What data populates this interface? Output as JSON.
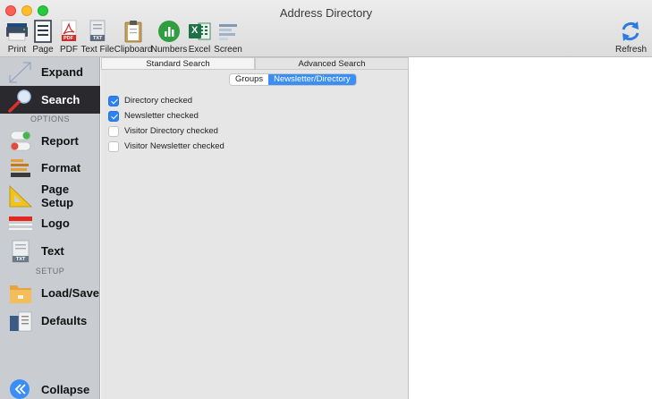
{
  "window": {
    "title": "Address Directory"
  },
  "toolbar": {
    "items": [
      {
        "label": "Print",
        "icon": "printer-icon"
      },
      {
        "label": "Page",
        "icon": "page-icon"
      },
      {
        "label": "PDF",
        "icon": "pdf-icon",
        "badge": "PDF"
      },
      {
        "label": "Text File",
        "icon": "text-file-icon",
        "badge": "TXT"
      },
      {
        "label": "Clipboard",
        "icon": "clipboard-icon"
      },
      {
        "label": "Numbers",
        "icon": "numbers-icon"
      },
      {
        "label": "Excel",
        "icon": "excel-icon",
        "badge": "X"
      },
      {
        "label": "Screen",
        "icon": "screen-icon"
      }
    ],
    "refresh_label": "Refresh"
  },
  "sidebar": {
    "items": [
      {
        "label": "Expand",
        "icon": "expand-icon"
      },
      {
        "label": "Search",
        "icon": "magnifier-icon",
        "selected": true
      },
      {
        "label": "Report",
        "icon": "toggle-switch-icon"
      },
      {
        "label": "Format",
        "icon": "format-icon"
      },
      {
        "label": "Page Setup",
        "icon": "set-square-icon"
      },
      {
        "label": "Logo",
        "icon": "logo-icon"
      },
      {
        "label": "Text",
        "icon": "text-doc-icon",
        "badge": "TXT"
      },
      {
        "label": "Load/Save",
        "icon": "folder-icon"
      },
      {
        "label": "Defaults",
        "icon": "defaults-icon"
      },
      {
        "label": "Collapse",
        "icon": "collapse-icon"
      }
    ],
    "sections": {
      "options": "OPTIONS",
      "setup": "SETUP"
    }
  },
  "main": {
    "tabs": [
      {
        "label": "Standard Search",
        "active": true
      },
      {
        "label": "Advanced Search",
        "active": false
      }
    ],
    "segments": [
      {
        "label": "Groups",
        "active": false
      },
      {
        "label": "Newsletter/Directory",
        "active": true
      }
    ],
    "checkboxes": [
      {
        "label": "Directory checked",
        "checked": true
      },
      {
        "label": "Newsletter checked",
        "checked": true
      },
      {
        "label": "Visitor Directory checked",
        "checked": false
      },
      {
        "label": "Visitor Newsletter checked",
        "checked": false
      }
    ]
  },
  "colors": {
    "accent": "#2d82f3",
    "sidebar_bg": "#c9cdd2",
    "selected_bg": "#2a2a2e"
  }
}
